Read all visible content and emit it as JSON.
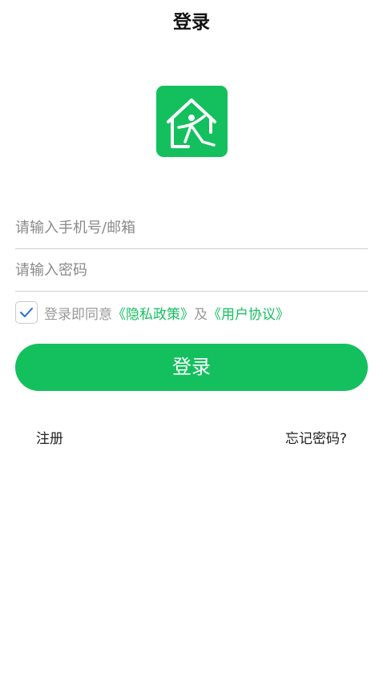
{
  "header": {
    "title": "登录"
  },
  "logo": {
    "icon": "house-person-logo-icon",
    "background_color": "#14c05e"
  },
  "form": {
    "account_placeholder": "请输入手机号/邮箱",
    "account_value": "",
    "password_placeholder": "请输入密码",
    "password_value": ""
  },
  "agreement": {
    "checked": true,
    "prefix": "登录即同意",
    "privacy_link": "《隐私政策》",
    "joiner": "及",
    "terms_link": "《用户协议》"
  },
  "actions": {
    "login_label": "登录",
    "register_label": "注册",
    "forgot_label": "忘记密码?"
  },
  "colors": {
    "accent": "#14c05e",
    "checkmark": "#1f6fd6",
    "divider": "#cfcfcf",
    "muted_text": "#9a9a9a"
  }
}
